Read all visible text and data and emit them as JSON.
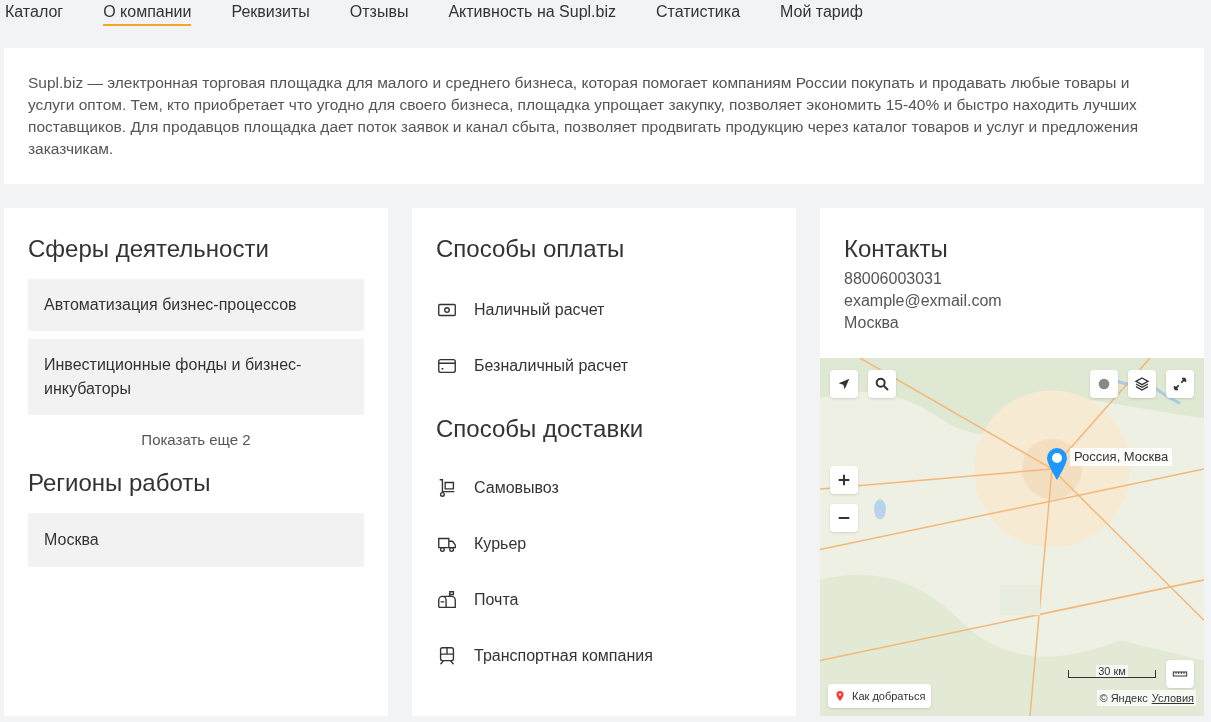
{
  "tabs": [
    {
      "label": "Каталог",
      "selected": false
    },
    {
      "label": "О компании",
      "selected": true
    },
    {
      "label": "Реквизиты",
      "selected": false
    },
    {
      "label": "Отзывы",
      "selected": false
    },
    {
      "label": "Активность на Supl.biz",
      "selected": false
    },
    {
      "label": "Статистика",
      "selected": false
    },
    {
      "label": "Мой тариф",
      "selected": false
    }
  ],
  "description": "Supl.biz — электронная торговая площадка для малого и среднего бизнеса, которая помогает компаниям России покупать и продавать любые товары и услуги оптом. Тем, кто приобретает что угодно для своего бизнеса, площадка упрощает закупку, позволяет экономить 15-40% и быстро находить лучших поставщиков. Для продавцов площадка дает поток заявок и канал сбыта, позволяет продвигать продукцию через каталог товаров и услуг и предложения заказчикам.",
  "activities": {
    "title": "Сферы деятельности",
    "items": [
      "Автоматизация бизнес-процессов",
      "Инвестиционные фонды и бизнес-инкубаторы"
    ],
    "show_more": "Показать еще 2"
  },
  "regions": {
    "title": "Регионы работы",
    "items": [
      "Москва"
    ]
  },
  "payment": {
    "title": "Способы оплаты",
    "items": [
      {
        "kind": "cash",
        "label": "Наличный расчет"
      },
      {
        "kind": "card",
        "label": "Безналичный расчет"
      }
    ]
  },
  "delivery": {
    "title": "Способы доставки",
    "items": [
      {
        "kind": "pickup",
        "label": "Самовывоз"
      },
      {
        "kind": "courier",
        "label": "Курьер"
      },
      {
        "kind": "mail",
        "label": "Почта"
      },
      {
        "kind": "transport",
        "label": "Транспортная компания"
      }
    ]
  },
  "contacts": {
    "title": "Контакты",
    "phone": "88006003031",
    "email": "example@exmail.com",
    "city": "Москва"
  },
  "map": {
    "kind": "picture",
    "placemark": "Россия, Москва",
    "route_button": "Как добраться",
    "scale": "30 км",
    "copyright": "© Яндекс",
    "terms_link": "Условия"
  }
}
